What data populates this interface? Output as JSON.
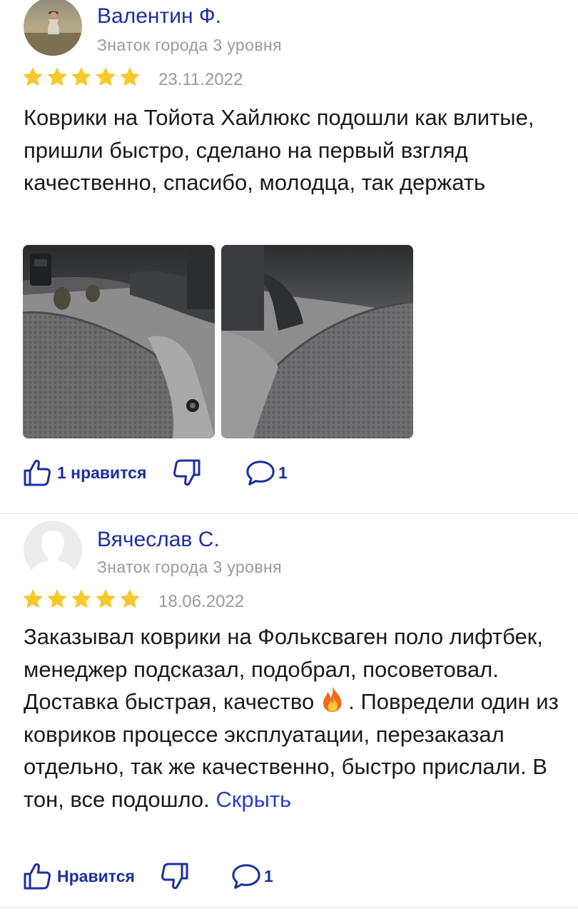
{
  "reviews": [
    {
      "author": "Валентин Ф.",
      "level": "Знаток города 3 уровня",
      "rating": 5,
      "date": "23.11.2022",
      "text": "Коврики на Тойота Хайлюкс подошли как влитые, пришли быстро, сделано на первый взгляд качественно, спасибо, молодца, так держать",
      "avatar_icon": "person-photo",
      "photos": [
        "car-floor-mat-photo",
        "car-floor-mat-photo"
      ],
      "like_label": "1 нравится",
      "comments_count": "1"
    },
    {
      "author": "Вячеслав С.",
      "level": "Знаток города 3 уровня",
      "rating": 5,
      "date": "18.06.2022",
      "text_part_1": "Заказывал коврики на Фольксваген поло лифтбек, менеджер подсказал, подобрал, посоветовал. Доставка быстрая, качество",
      "text_emoji": "fire-emoji",
      "text_part_2": ". Повредели один из ковриков процессе эксплуатации, перезаказал отдельно, так же качественно, быстро прислали. В тон, все подошло.",
      "collapse_label": "Скрыть",
      "avatar_icon": "default-user-avatar",
      "like_label": "Нравится",
      "comments_count": "1"
    }
  ],
  "colors": {
    "accent": "#1c2fa0",
    "star": "#f5c82c",
    "muted": "#9a9a9a",
    "link": "#2a3fc4"
  }
}
